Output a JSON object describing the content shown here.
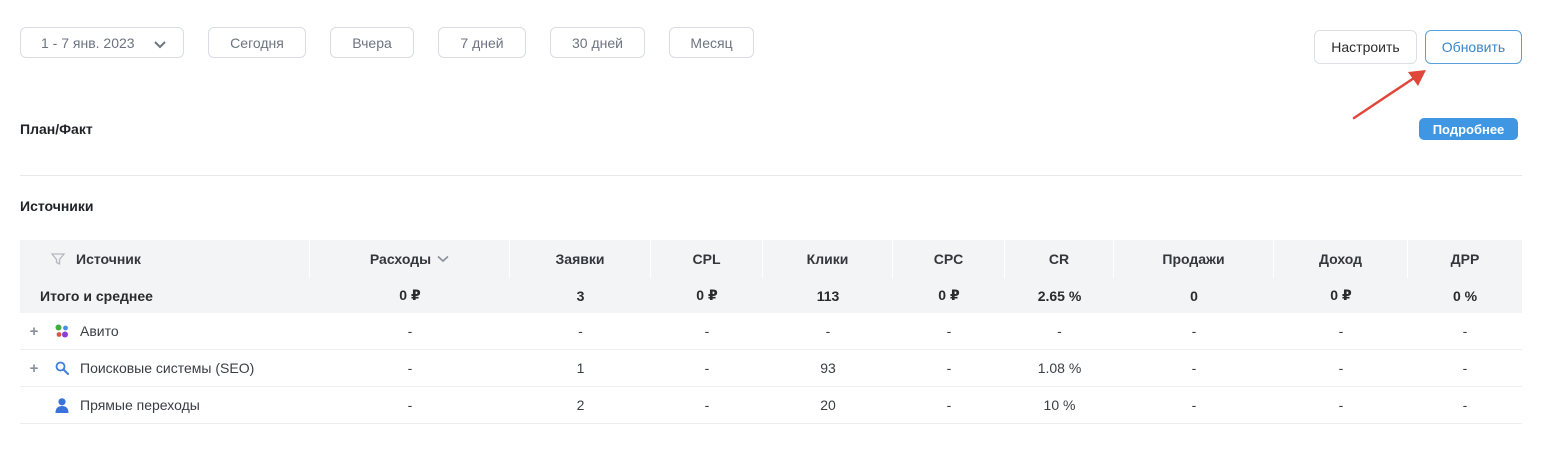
{
  "toolbar": {
    "date_range": "1 - 7 янв. 2023",
    "presets": [
      "Сегодня",
      "Вчера",
      "7 дней",
      "30 дней",
      "Месяц"
    ],
    "configure_label": "Настроить",
    "refresh_label": "Обновить"
  },
  "plan": {
    "title": "План/Факт",
    "more_label": "Подробнее"
  },
  "sources": {
    "title": "Источники",
    "columns": [
      "Источник",
      "Расходы",
      "Заявки",
      "CPL",
      "Клики",
      "CPC",
      "CR",
      "Продажи",
      "Доход",
      "ДРР"
    ],
    "total": {
      "label": "Итого и среднее",
      "values": [
        "0 ₽",
        "3",
        "0 ₽",
        "113",
        "0 ₽",
        "2.65 %",
        "0",
        "0 ₽",
        "0 %"
      ]
    },
    "rows": [
      {
        "name": "Авито",
        "expandable": true,
        "icon": "avito-dots-icon",
        "values": [
          "-",
          "-",
          "-",
          "-",
          "-",
          "-",
          "-",
          "-",
          "-"
        ]
      },
      {
        "name": "Поисковые системы (SEO)",
        "expandable": true,
        "icon": "search-icon",
        "values": [
          "-",
          "1",
          "-",
          "93",
          "-",
          "1.08 %",
          "-",
          "-",
          "-"
        ]
      },
      {
        "name": "Прямые переходы",
        "expandable": false,
        "icon": "user-icon",
        "values": [
          "-",
          "2",
          "-",
          "20",
          "-",
          "10 %",
          "-",
          "-",
          "-"
        ]
      }
    ]
  },
  "colors": {
    "accent": "#3f97e3",
    "annotation_arrow": "#e0473b",
    "header_bg": "#f3f4f6"
  }
}
